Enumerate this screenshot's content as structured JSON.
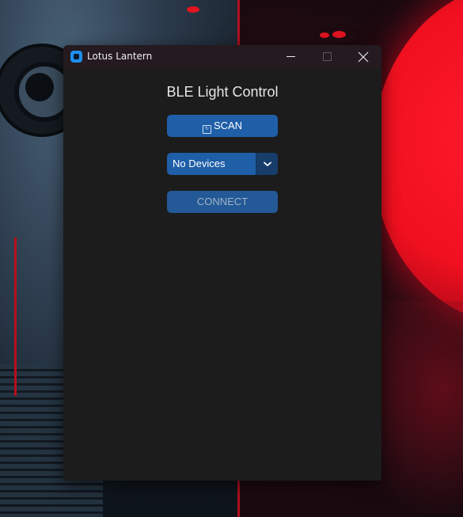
{
  "window": {
    "title": "Lotus Lantern",
    "controls": {
      "minimize_icon": "minimize-icon",
      "maximize_icon": "maximize-icon",
      "close_icon": "close-icon"
    },
    "app_icon": "app-icon"
  },
  "main": {
    "heading": "BLE Light Control",
    "scan_button": {
      "icon": "scan-icon",
      "label": "SCAN"
    },
    "device_select": {
      "value": "No Devices",
      "arrow_icon": "chevron-down-icon"
    },
    "connect_button": {
      "label": "CONNECT",
      "enabled": false
    }
  },
  "colors": {
    "button_bg": "#1f5fa8",
    "window_bg": "#1c1c1c",
    "titlebar_bg": "#241a20",
    "app_icon": "#1d8ff0"
  }
}
